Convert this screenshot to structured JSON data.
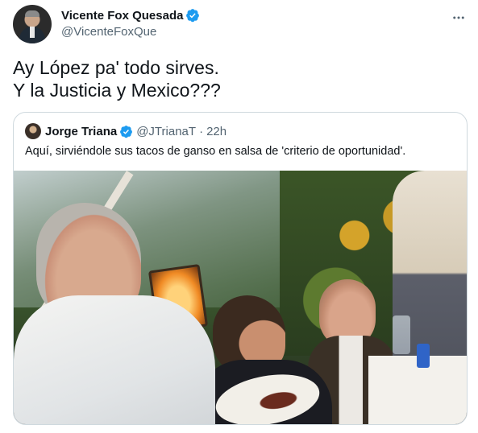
{
  "tweet": {
    "author_name": "Vicente Fox Quesada",
    "author_handle": "@VicenteFoxQue",
    "text_line1": "Ay López pa' todo sirves.",
    "text_line2": "Y la Justicia y Mexico???",
    "more_icon": "more-horizontal-icon"
  },
  "quoted": {
    "author_name": "Jorge Triana",
    "author_handle": "@JTrianaT",
    "separator": "·",
    "time": "22h",
    "text": "Aquí, sirviéndole sus tacos de ganso en salsa de 'criterio de oportunidad'."
  },
  "colors": {
    "verified_blue": "#1d9bf0",
    "secondary_text": "#536471",
    "border": "#cfd9de"
  }
}
